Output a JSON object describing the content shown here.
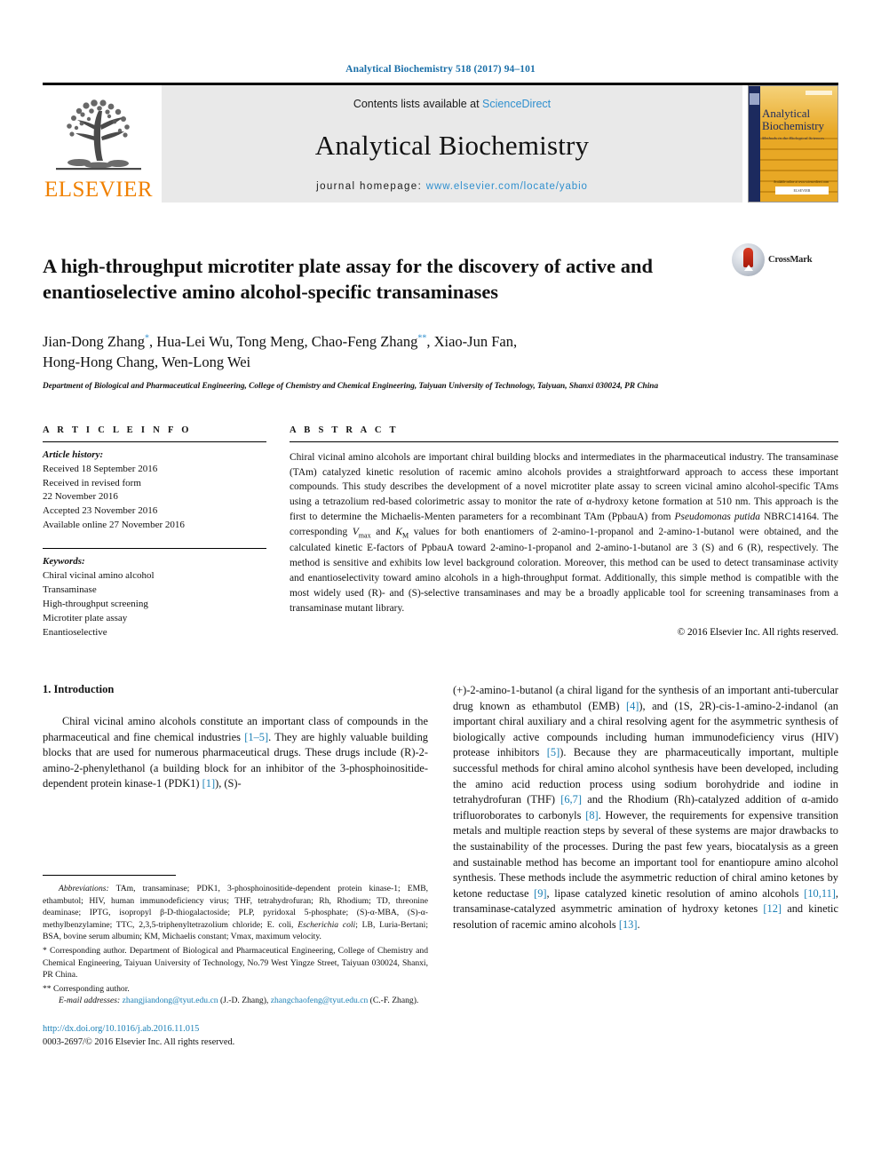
{
  "running_head": "Analytical Biochemistry 518 (2017) 94–101",
  "masthead": {
    "publisher_logo_text": "ELSEVIER",
    "contents_prefix": "Contents lists available at ",
    "contents_link": "ScienceDirect",
    "journal_title": "Analytical Biochemistry",
    "homepage_prefix": "journal homepage: ",
    "homepage_url": "www.elsevier.com/locate/yabio",
    "cover": {
      "title_line1": "Analytical",
      "title_line2": "Biochemistry",
      "subtitle": "Methods in the Biological Sciences",
      "footer_badge": "ELSEVIER",
      "footer_small": "Available online at www.sciencedirect.com"
    }
  },
  "article": {
    "title": "A high-throughput microtiter plate assay for the discovery of active and enantioselective amino alcohol-specific transaminases",
    "crossmark_label": "CrossMark",
    "authors_line1": "Jian-Dong Zhang",
    "authors_line1_b": ", Hua-Lei Wu, Tong Meng, Chao-Feng Zhang",
    "authors_line1_c": ", Xiao-Jun Fan,",
    "authors_line2": "Hong-Hong Chang, Wen-Long Wei",
    "author_mark1": "*",
    "author_mark2": "**",
    "affiliation": "Department of Biological and Pharmaceutical Engineering, College of Chemistry and Chemical Engineering, Taiyuan University of Technology, Taiyuan, Shanxi 030024, PR China"
  },
  "sections": {
    "article_info_heading": "A R T I C L E  I N F O",
    "abstract_heading": "A B S T R A C T"
  },
  "article_history": {
    "label": "Article history:",
    "lines": [
      "Received 18 September 2016",
      "Received in revised form",
      "22 November 2016",
      "Accepted 23 November 2016",
      "Available online 27 November 2016"
    ]
  },
  "keywords": {
    "label": "Keywords:",
    "items": [
      "Chiral vicinal amino alcohol",
      "Transaminase",
      "High-throughput screening",
      "Microtiter plate assay",
      "Enantioselective"
    ]
  },
  "abstract": {
    "p1": "Chiral vicinal amino alcohols are important chiral building blocks and intermediates in the pharmaceutical industry. The transaminase (TAm) catalyzed kinetic resolution of racemic amino alcohols provides a straightforward approach to access these important compounds. This study describes the development of a novel microtiter plate assay to screen vicinal amino alcohol-specific TAms using a tetrazolium red-based colorimetric assay to monitor the rate of α-hydroxy ketone formation at 510 nm. This approach is the first to determine the Michaelis-Menten parameters for a recombinant TAm (PpbauA) from ",
    "organism": "Pseudomonas putida",
    "p2": " NBRC14164. The corresponding ",
    "vmax_italic": "V",
    "vmax_sub": "max",
    "p3": " and ",
    "km_italic": "K",
    "km_sub": "M",
    "p4": " values for both enantiomers of 2-amino-1-propanol and 2-amino-1-butanol were obtained, and the calculated kinetic E-factors of PpbauA toward 2-amino-1-propanol and 2-amino-1-butanol are 3 (S) and 6 (R), respectively. The method is sensitive and exhibits low level background coloration. Moreover, this method can be used to detect transaminase activity and enantioselectivity toward amino alcohols in a high-throughput format. Additionally, this simple method is compatible with the most widely used (R)- and (S)-selective transaminases and may be a broadly applicable tool for screening transaminases from a transaminase mutant library.",
    "copyright": "© 2016 Elsevier Inc. All rights reserved."
  },
  "intro": {
    "heading": "1. Introduction",
    "left_p1_a": "Chiral vicinal amino alcohols constitute an important class of compounds in the pharmaceutical and fine chemical industries ",
    "left_ref1": "[1–5]",
    "left_p1_b": ". They are highly valuable building blocks that are used for numerous pharmaceutical drugs. These drugs include (R)-2-amino-2-phenylethanol (a building block for an inhibitor of the 3-phosphoinositide-dependent protein kinase-1 (PDK1) ",
    "left_ref2": "[1]",
    "left_p1_c": "), (S)-",
    "right_p1_a": "(+)-2-amino-1-butanol (a chiral ligand for the synthesis of an important anti-tubercular drug known as ethambutol (EMB) ",
    "right_ref4": "[4]",
    "right_p1_b": "), and (1S, 2R)-cis-1-amino-2-indanol (an important chiral auxiliary and a chiral resolving agent for the asymmetric synthesis of biologically active compounds including human immunodeficiency virus (HIV) protease inhibitors ",
    "right_ref5": "[5]",
    "right_p1_c": "). Because they are pharmaceutically important, multiple successful methods for chiral amino alcohol synthesis have been developed, including the amino acid reduction process using sodium borohydride and iodine in tetrahydrofuran (THF) ",
    "right_ref67": "[6,7]",
    "right_p1_d": " and the Rhodium (Rh)-catalyzed addition of α-amido trifluoroborates to carbonyls ",
    "right_ref8": "[8]",
    "right_p1_e": ". However, the requirements for expensive transition metals and multiple reaction steps by several of these systems are major drawbacks to the sustainability of the processes. During the past few years, biocatalysis as a green and sustainable method has become an important tool for enantiopure amino alcohol synthesis. These methods include the asymmetric reduction of chiral amino ketones by ketone reductase ",
    "right_ref9": "[9]",
    "right_p1_f": ", lipase catalyzed kinetic resolution of amino alcohols ",
    "right_ref1011": "[10,11]",
    "right_p1_g": ", transaminase-catalyzed asymmetric amination of hydroxy ketones ",
    "right_ref12": "[12]",
    "right_p1_h": " and kinetic resolution of racemic amino alcohols ",
    "right_ref13": "[13]",
    "right_p1_i": "."
  },
  "footnotes": {
    "abbrev_label": "Abbreviations:",
    "abbrev_text": " TAm, transaminase; PDK1, 3-phosphoinositide-dependent protein kinase-1; EMB, ethambutol; HIV, human immunodeficiency virus; THF, tetrahydrofuran; Rh, Rhodium; TD, threonine deaminase; IPTG, isopropyl β-D-thiogalactoside; PLP, pyridoxal 5-phosphate; (S)-α-MBA, (S)-α-methylbenzylamine; TTC, 2,3,5-triphenyltetrazolium chloride; ",
    "abbrev_ecoli_plain": "E. coli",
    "abbrev_ecoli_mid": ", ",
    "abbrev_ecoli_italic": "Escherichia coli",
    "abbrev_tail": "; LB, Luria-Bertani; BSA, bovine serum albumin; KM, Michaelis constant; Vmax, maximum velocity.",
    "corr1_mark": "*",
    "corr1_text": " Corresponding author. Department of Biological and Pharmaceutical Engineering, College of Chemistry and Chemical Engineering, Taiyuan University of Technology, No.79 West Yingze Street, Taiyuan 030024, Shanxi, PR China.",
    "corr2_mark": "**",
    "corr2_text": " Corresponding author.",
    "email_label": "E-mail addresses:",
    "email1": "zhangjiandong@tyut.edu.cn",
    "email1_who": " (J.-D. Zhang), ",
    "email2": "zhangchaofeng@tyut.edu.cn",
    "email2_who": " (C.-F. Zhang).",
    "doi": "http://dx.doi.org/10.1016/j.ab.2016.11.015",
    "issn": "0003-2697/© 2016 Elsevier Inc. All rights reserved."
  },
  "colors": {
    "link_blue": "#1a7fb5",
    "header_blue": "#1a6fa8",
    "elsevier_orange": "#F08000",
    "band_gray": "#e9e9e9"
  }
}
